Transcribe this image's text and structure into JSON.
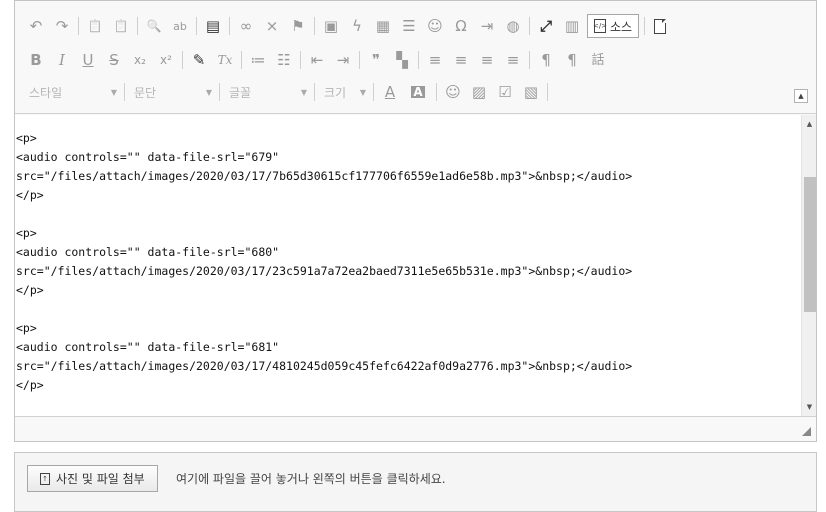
{
  "toolbar": {
    "row1": {
      "undo_icon": "↶",
      "redo_icon": "↷",
      "paste_text_icon": "📋",
      "paste_word_icon": "📋",
      "find_icon": "🔍",
      "replace_icon": "ab",
      "template_icon": "▤",
      "link_icon": "∞",
      "unlink_icon": "⨯",
      "anchor_icon": "⚑",
      "image_icon": "▣",
      "flash_icon": "ϟ",
      "table_icon": "▦",
      "hr_icon": "☰",
      "smiley_icon": "☺",
      "special_char_icon": "Ω",
      "page_break_icon": "⇥",
      "iframe_icon": "◍",
      "maximize_icon": "⤢",
      "show_blocks_icon": "▥",
      "source_label": "소스",
      "source_icon": "</>"
    },
    "row2": {
      "bold": "B",
      "italic": "I",
      "underline": "U",
      "strike": "S",
      "subscript": "x₂",
      "superscript": "x²",
      "copy_format_icon": "✎",
      "remove_format_icon": "Tx",
      "numbered_list_icon": "≔",
      "bulleted_list_icon": "☷",
      "outdent_icon": "⇤",
      "indent_icon": "⇥",
      "blockquote_icon": "❞",
      "div_icon": "▚",
      "align_left_icon": "≡",
      "align_center_icon": "≡",
      "align_right_icon": "≡",
      "justify_icon": "≡",
      "ltr_icon": "¶",
      "rtl_icon": "¶",
      "language_icon": "話"
    },
    "row3": {
      "style_combo": "스타일",
      "paragraph_combo": "문단",
      "font_combo": "글꼴",
      "size_combo": "크기",
      "text_color_icon": "A",
      "bg_color_icon": "A",
      "emoji_icon": "☺",
      "image2_icon": "▨",
      "checkbox_icon": "☑",
      "gallery_icon": "▧",
      "collapse_icon": "▲"
    }
  },
  "content": {
    "source_code": "<p>\n<audio controls=\"\" data-file-srl=\"679\"\nsrc=\"/files/attach/images/2020/03/17/7b65d30615cf177706f6559e1ad6e58b.mp3\">&nbsp;</audio>\n</p>\n\n<p>\n<audio controls=\"\" data-file-srl=\"680\"\nsrc=\"/files/attach/images/2020/03/17/23c591a7a72ea2baed7311e5e65b531e.mp3\">&nbsp;</audio>\n</p>\n\n<p>\n<audio controls=\"\" data-file-srl=\"681\"\nsrc=\"/files/attach/images/2020/03/17/4810245d059c45fefc6422af0d9a2776.mp3\">&nbsp;</audio>\n</p>"
  },
  "scrollbar": {
    "up_icon": "▲",
    "down_icon": "▼"
  },
  "attach": {
    "button_label": "사진 및 파일 첨부",
    "button_icon": "↑",
    "hint": "여기에 파일을 끌어 놓거나 왼쪽의 버튼을 클릭하세요."
  }
}
